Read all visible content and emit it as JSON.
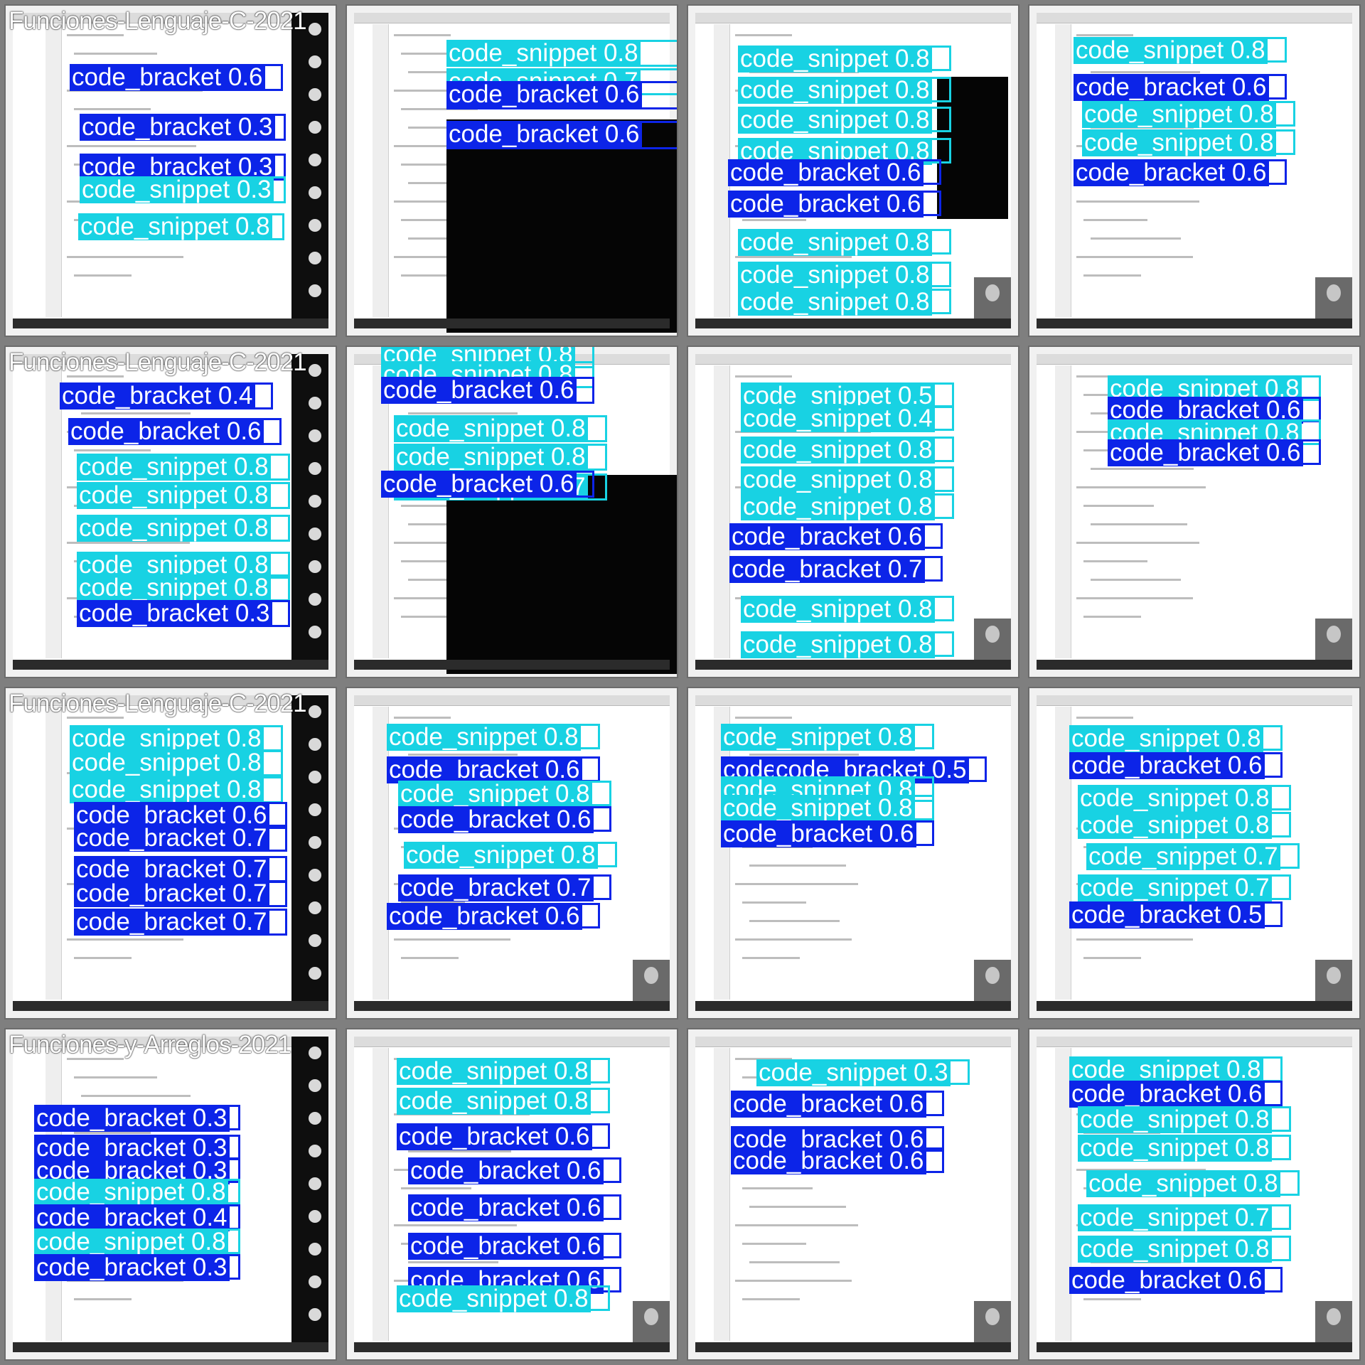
{
  "colors": {
    "code_snippet": "#18d2e3",
    "code_bracket": "#0c24e8",
    "background": "#7f7f7f"
  },
  "classes": [
    "code_snippet",
    "code_bracket"
  ],
  "tiles": [
    {
      "title": "Funciones-Lenguaje-C-2021",
      "scene": "ide-participants",
      "detections": [
        {
          "cls": "code_bracket",
          "score": "0.6"
        },
        {
          "cls": "code_bracket",
          "score": "0.3"
        },
        {
          "cls": "code_bracket",
          "score": "0.3"
        },
        {
          "cls": "code_snippet",
          "score": "0.3"
        },
        {
          "cls": "code_snippet",
          "score": "0.8"
        }
      ]
    },
    {
      "title": "",
      "scene": "editor-console",
      "detections": [
        {
          "cls": "code_snippet",
          "score": "0.8"
        },
        {
          "cls": "code_snippet",
          "score": "0.7"
        },
        {
          "cls": "code_bracket",
          "score": "0.6"
        },
        {
          "cls": "code_bracket",
          "score": "0.6"
        }
      ]
    },
    {
      "title": "",
      "scene": "editor-console-webcam",
      "detections": [
        {
          "cls": "code_snippet",
          "score": "0.8"
        },
        {
          "cls": "code_snippet",
          "score": "0.8"
        },
        {
          "cls": "code_snippet",
          "score": "0.8"
        },
        {
          "cls": "code_snippet",
          "score": "0.8"
        },
        {
          "cls": "code_bracket",
          "score": "0.6"
        },
        {
          "cls": "code_bracket",
          "score": "0.6"
        },
        {
          "cls": "code_snippet",
          "score": "0.8"
        },
        {
          "cls": "code_snippet",
          "score": "0.8"
        },
        {
          "cls": "code_snippet",
          "score": "0.8"
        }
      ]
    },
    {
      "title": "",
      "scene": "editor-webcam",
      "detections": [
        {
          "cls": "code_snippet",
          "score": "0.8"
        },
        {
          "cls": "code_bracket",
          "score": "0.6"
        },
        {
          "cls": "code_snippet",
          "score": "0.8"
        },
        {
          "cls": "code_snippet",
          "score": "0.8"
        },
        {
          "cls": "code_bracket",
          "score": "0.6"
        }
      ]
    },
    {
      "title": "Funciones-Lenguaje-C-2021",
      "scene": "ide-participants",
      "detections": [
        {
          "cls": "code_bracket",
          "score": "0.4"
        },
        {
          "cls": "code_bracket",
          "score": "0.6"
        },
        {
          "cls": "code_snippet",
          "score": "0.8"
        },
        {
          "cls": "code_snippet",
          "score": "0.8"
        },
        {
          "cls": "code_snippet",
          "score": "0.8"
        },
        {
          "cls": "code_snippet",
          "score": "0.8"
        },
        {
          "cls": "code_snippet",
          "score": "0.8"
        },
        {
          "cls": "code_bracket",
          "score": "0.3"
        }
      ]
    },
    {
      "title": "",
      "scene": "editor-console",
      "detections": [
        {
          "cls": "code_snippet",
          "score": "0.8"
        },
        {
          "cls": "code_snippet",
          "score": "0.8"
        },
        {
          "cls": "code_bracket",
          "score": "0.6"
        },
        {
          "cls": "code_snippet",
          "score": "0.8"
        },
        {
          "cls": "code_snippet",
          "score": "0.8"
        },
        {
          "cls": "code_snippet",
          "score": "0.7"
        },
        {
          "cls": "code_bracket",
          "score": "0.6"
        }
      ]
    },
    {
      "title": "",
      "scene": "editor-webcam",
      "detections": [
        {
          "cls": "code_snippet",
          "score": "0.5"
        },
        {
          "cls": "code_snippet",
          "score": "0.4"
        },
        {
          "cls": "code_snippet",
          "score": "0.8"
        },
        {
          "cls": "code_snippet",
          "score": "0.8"
        },
        {
          "cls": "code_snippet",
          "score": "0.8"
        },
        {
          "cls": "code_bracket",
          "score": "0.6"
        },
        {
          "cls": "code_bracket",
          "score": "0.7"
        },
        {
          "cls": "code_snippet",
          "score": "0.8"
        },
        {
          "cls": "code_snippet",
          "score": "0.8"
        }
      ]
    },
    {
      "title": "",
      "scene": "editor-webcam",
      "detections": [
        {
          "cls": "code_snippet",
          "score": "0.8"
        },
        {
          "cls": "code_bracket",
          "score": "0.6"
        },
        {
          "cls": "code_snippet",
          "score": "0.8"
        },
        {
          "cls": "code_bracket",
          "score": "0.6"
        }
      ]
    },
    {
      "title": "Funciones-Lenguaje-C-2021",
      "scene": "ide-participants",
      "detections": [
        {
          "cls": "code_snippet",
          "score": "0.8"
        },
        {
          "cls": "code_snippet",
          "score": "0.8"
        },
        {
          "cls": "code_snippet",
          "score": "0.8"
        },
        {
          "cls": "code_bracket",
          "score": "0.6"
        },
        {
          "cls": "code_bracket",
          "score": "0.7"
        },
        {
          "cls": "code_bracket",
          "score": "0.7"
        },
        {
          "cls": "code_bracket",
          "score": "0.7"
        },
        {
          "cls": "code_bracket",
          "score": "0.7"
        }
      ]
    },
    {
      "title": "",
      "scene": "editor-webcam",
      "detections": [
        {
          "cls": "code_snippet",
          "score": "0.8"
        },
        {
          "cls": "code_bracket",
          "score": "0.6"
        },
        {
          "cls": "code_snippet",
          "score": "0.8"
        },
        {
          "cls": "code_bracket",
          "score": "0.6"
        },
        {
          "cls": "code_snippet",
          "score": "0.8"
        },
        {
          "cls": "code_bracket",
          "score": "0.7"
        },
        {
          "cls": "code_bracket",
          "score": "0.6"
        }
      ]
    },
    {
      "title": "",
      "scene": "editor-webcam",
      "detections": [
        {
          "cls": "code_snippet",
          "score": "0.8"
        },
        {
          "cls": "code_bracket",
          "score": "0.6"
        },
        {
          "cls": "code_bracket",
          "score": "0.5"
        },
        {
          "cls": "code_snippet",
          "score": "0.8"
        },
        {
          "cls": "code_snippet",
          "score": "0.8"
        },
        {
          "cls": "code_bracket",
          "score": "0.6"
        }
      ]
    },
    {
      "title": "",
      "scene": "editor-webcam",
      "detections": [
        {
          "cls": "code_snippet",
          "score": "0.8"
        },
        {
          "cls": "code_bracket",
          "score": "0.6"
        },
        {
          "cls": "code_snippet",
          "score": "0.8"
        },
        {
          "cls": "code_snippet",
          "score": "0.8"
        },
        {
          "cls": "code_snippet",
          "score": "0.7"
        },
        {
          "cls": "code_snippet",
          "score": "0.7"
        },
        {
          "cls": "code_bracket",
          "score": "0.5"
        }
      ]
    },
    {
      "title": "Funciones-y-Arreglos-2021",
      "scene": "ide-participants",
      "detections": [
        {
          "cls": "code_bracket",
          "score": "0.3"
        },
        {
          "cls": "code_bracket",
          "score": "0.3"
        },
        {
          "cls": "code_bracket",
          "score": "0.3"
        },
        {
          "cls": "code_snippet",
          "score": "0.8"
        },
        {
          "cls": "code_bracket",
          "score": "0.4"
        },
        {
          "cls": "code_snippet",
          "score": "0.8"
        },
        {
          "cls": "code_bracket",
          "score": "0.3"
        }
      ]
    },
    {
      "title": "",
      "scene": "editor-webcam",
      "detections": [
        {
          "cls": "code_snippet",
          "score": "0.8"
        },
        {
          "cls": "code_snippet",
          "score": "0.8"
        },
        {
          "cls": "code_bracket",
          "score": "0.6"
        },
        {
          "cls": "code_bracket",
          "score": "0.6"
        },
        {
          "cls": "code_bracket",
          "score": "0.6"
        },
        {
          "cls": "code_bracket",
          "score": "0.6"
        },
        {
          "cls": "code_bracket",
          "score": "0.6"
        },
        {
          "cls": "code_snippet",
          "score": "0.8"
        }
      ]
    },
    {
      "title": "",
      "scene": "editor-webcam",
      "detections": [
        {
          "cls": "code_snippet",
          "score": "0.3"
        },
        {
          "cls": "code_bracket",
          "score": "0.6"
        },
        {
          "cls": "code_bracket",
          "score": "0.6"
        },
        {
          "cls": "code_bracket",
          "score": "0.6"
        }
      ]
    },
    {
      "title": "",
      "scene": "editor-webcam",
      "detections": [
        {
          "cls": "code_snippet",
          "score": "0.8"
        },
        {
          "cls": "code_bracket",
          "score": "0.6"
        },
        {
          "cls": "code_snippet",
          "score": "0.8"
        },
        {
          "cls": "code_snippet",
          "score": "0.8"
        },
        {
          "cls": "code_snippet",
          "score": "0.8"
        },
        {
          "cls": "code_snippet",
          "score": "0.7"
        },
        {
          "cls": "code_snippet",
          "score": "0.8"
        },
        {
          "cls": "code_bracket",
          "score": "0.6"
        }
      ]
    }
  ]
}
